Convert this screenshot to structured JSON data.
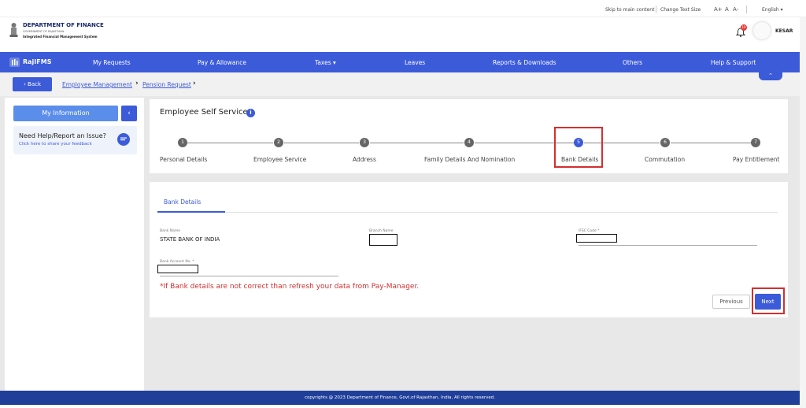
{
  "topbar": {
    "skip": "Skip to main content",
    "text_size": "Change Text Size",
    "a_plus": "A+",
    "a": "A",
    "a_minus": "A-",
    "language": "English ▾"
  },
  "header": {
    "dept_title": "DEPARTMENT OF FINANCE",
    "dept_sub": "GOVERNMENT OF RAJASTHAN",
    "system": "Integrated Financial Management System",
    "notification_count": "10",
    "user": "KESAR"
  },
  "nav": {
    "brand": "RajIFMS",
    "items": [
      "My Requests",
      "Pay & Allowance",
      "Taxes ▾",
      "Leaves",
      "Reports & Downloads",
      "Others",
      "Help & Support"
    ]
  },
  "breadcrumb": {
    "back": "Back",
    "items": [
      "Employee Management",
      "Pension Request"
    ]
  },
  "sidebar": {
    "my_info": "My Information",
    "help_title": "Need Help/Report an Issue?",
    "help_sub": "Click here to share your feedback"
  },
  "ess": {
    "title": "Employee Self Service",
    "steps": [
      {
        "num": "1",
        "label": "Personal Details"
      },
      {
        "num": "2",
        "label": "Employee Service"
      },
      {
        "num": "3",
        "label": "Address"
      },
      {
        "num": "4",
        "label": "Family Details And Nomination"
      },
      {
        "num": "5",
        "label": "Bank Details"
      },
      {
        "num": "6",
        "label": "Commutation"
      },
      {
        "num": "7",
        "label": "Pay Entitlement"
      }
    ],
    "active_step": 5
  },
  "bank": {
    "tab": "Bank Details",
    "bank_name_label": "Bank Name",
    "bank_name_value": "STATE BANK OF INDIA",
    "branch_label": "Branch Name",
    "ifsc_label": "IFSC Code *",
    "account_label": "Bank Account No. *",
    "warning": "*If Bank details are not correct than refresh your data from Pay-Manager.",
    "previous": "Previous",
    "next": "Next"
  },
  "footer": {
    "text": "copyrights @ 2023 Department of Finance, Govt.of Rajasthan, India, All rights reserved."
  }
}
